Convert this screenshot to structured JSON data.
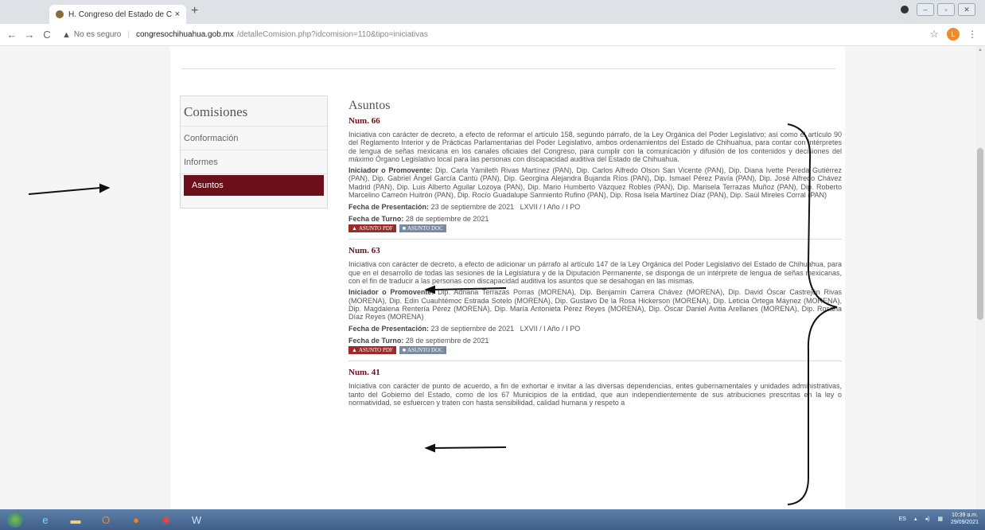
{
  "browser": {
    "tab_title": "H. Congreso del Estado de Chih...",
    "tab_close": "×",
    "new_tab": "+",
    "insecure_label": "No es seguro",
    "url_host": "congresochihuahua.gob.mx",
    "url_path": "/detalleComision.php?idcomision=110&tipo=iniciativas",
    "profile_initial": "L"
  },
  "sidebar": {
    "title": "Comisiones",
    "items": [
      {
        "label": "Conformación"
      },
      {
        "label": "Informes"
      },
      {
        "label": "Asuntos"
      }
    ]
  },
  "content": {
    "heading": "Asuntos",
    "items": [
      {
        "num": "Num. 66",
        "description": "Iniciativa con carácter de decreto, a efecto de reformar el artículo 158, segundo párrafo, de la Ley Orgánica del Poder Legislativo; así como el artículo 90 del Reglamento Interior y de Prácticas Parlamentarias del Poder Legislativo, ambos ordenamientos del Estado de Chihuahua, para contar con intérpretes de lengua de señas mexicana en los canales oficiales del Congreso, para cumplir con la comunicación y difusión de los contenidos y decisiones del máximo Órgano Legislativo local para las personas con discapacidad auditiva del Estado de Chihuahua.",
        "promovente_label": "Iniciador o Promovente:",
        "promovente": "Dip. Carla Yamileth Rivas Martínez (PAN), Dip. Carlos Alfredo Olson San Vicente (PAN), Dip. Diana Ivette Pereda Gutiérrez (PAN), Dip. Gabriel Ángel García Cantú (PAN), Dip. Georgina Alejandra Bujanda Ríos (PAN), Dip. Ismael Pérez Pavía (PAN), Dip. José Alfredo Chávez Madrid (PAN), Dip. Luis Alberto Aguilar Lozoya (PAN), Dip. Mario Humberto Vázquez Robles (PAN), Dip. Marisela Terrazas Muñoz (PAN), Dip. Roberto Marcelino Carreón Huitrón (PAN), Dip. Rocío Guadalupe Sarmiento Rufino (PAN), Dip. Rosa Isela Martínez Díaz (PAN), Dip. Saúl Mireles Corral (PAN)",
        "fecha_presentacion_label": "Fecha de Presentación:",
        "fecha_presentacion": "23 de septiembre de 2021",
        "legislatura": "LXVII / I Año / I PO",
        "fecha_turno_label": "Fecha de Turno:",
        "fecha_turno": "28 de septiembre de 2021",
        "pdf_label": "ASUNTO PDF",
        "doc_label": "ASUNTO DOC"
      },
      {
        "num": "Num. 63",
        "description": "Iniciativa con carácter de decreto, a efecto de adicionar un párrafo al artículo 147 de la Ley Orgánica del Poder Legislativo del Estado de Chihuahua, para que en el desarrollo de todas las sesiones de la Legislatura y de la Diputación Permanente, se disponga de un intérprete de lengua de señas mexicanas, con el fin de traducir a las personas con discapacidad auditiva los asuntos que se desahogan en las mismas.",
        "promovente_label": "Iniciador o Promovente:",
        "promovente": "Dip. Adriana Terrazas Porras (MORENA), Dip. Benjamín Carrera Chávez (MORENA), Dip. David Óscar Castrejón Rivas (MORENA), Dip. Edin Cuauhtémoc Estrada Sotelo (MORENA), Dip. Gustavo De la Rosa Hickerson (MORENA), Dip. Leticia Ortega Máynez (MORENA), Dip. Magdalena Rentería Pérez (MORENA), Dip. María Antonieta Pérez Reyes (MORENA), Dip. Óscar Daniel Avitia Arellanes (MORENA), Dip. Rosana Díaz Reyes (MORENA)",
        "fecha_presentacion_label": "Fecha de Presentación:",
        "fecha_presentacion": "23 de septiembre de 2021",
        "legislatura": "LXVII / I Año / I PO",
        "fecha_turno_label": "Fecha de Turno:",
        "fecha_turno": "28 de septiembre de 2021",
        "pdf_label": "ASUNTO PDF",
        "doc_label": "ASUNTO DOC"
      },
      {
        "num": "Num. 41",
        "description": "Iniciativa con carácter de punto de acuerdo, a fin de exhortar e invitar a las diversas dependencias, entes gubernamentales y unidades administrativas, tanto del Gobierno del Estado, como de los 67 Municipios de la entidad, que aun independientemente de sus atribuciones prescritas en la ley o normatividad, se esfuercen y traten con hasta sensibilidad, calidad humana y respeto a"
      }
    ]
  },
  "taskbar": {
    "lang": "ES",
    "time": "10:39 a.m.",
    "date": "29/09/2021"
  }
}
